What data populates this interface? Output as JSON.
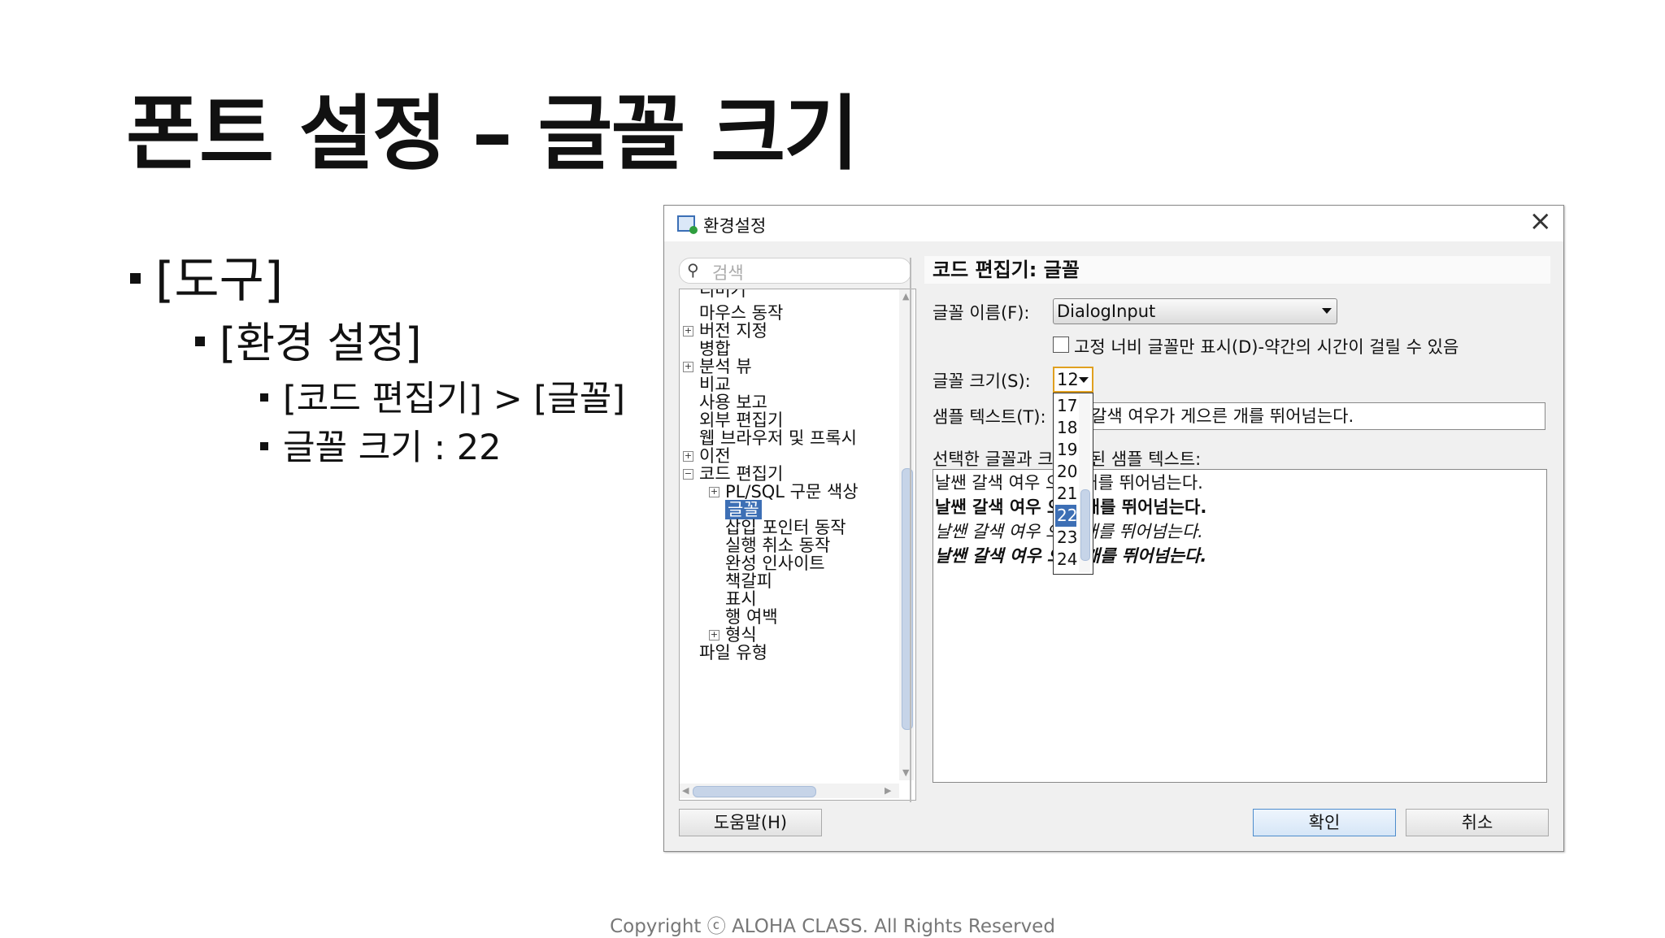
{
  "slide": {
    "title": "폰트 설정 – 글꼴 크기",
    "bullets": [
      "[도구]",
      "[환경 설정]",
      "[코드 편집기] > [글꼴]",
      "글꼴 크기 : 22"
    ],
    "footer": "Copyright ⓒ ALOHA CLASS. All Rights Reserved"
  },
  "dialog": {
    "title": "환경설정",
    "search_placeholder": "검색",
    "tree": [
      "디버거",
      "마우스 동작",
      "버전 지정",
      "병합",
      "분석 뷰",
      "비교",
      "사용 보고",
      "외부 편집기",
      "웹 브라우저 및 프록시",
      "이전",
      "코드 편집기",
      "PL/SQL 구문 색상",
      "글꼴",
      "삽입 포인터 동작",
      "실행 취소 동작",
      "완성 인사이트",
      "책갈피",
      "표시",
      "행 여백",
      "형식",
      "파일 유형"
    ],
    "section_title": "코드 편집기: 글꼴",
    "font_name_label": "글꼴 이름(F):",
    "font_name_value": "DialogInput",
    "fixed_width_label": "고정 너비 글꼴만 표시(D)-약간의 시간이 걸릴 수 있음",
    "font_size_label": "글꼴 크기(S):",
    "font_size_value": "12",
    "sample_text_label": "샘플 텍스트(T):",
    "sample_text_value": "갈색 여우가 게으른 개를 뛰어넘는다.",
    "preview_label": "선택한 글꼴과 크  표시된 샘플 텍스트:",
    "preview_lines": [
      "날쌘 갈색 여우   으른 개를 뛰어넘는다.",
      "날쌘 갈색 여우   으른 개를 뛰어넘는다.",
      "날쌘 갈색 여우   으른 개를 뛰어넘는다.",
      "날쌘 갈색 여우   으른 개를 뛰어넘는다."
    ],
    "size_options": [
      "17",
      "18",
      "19",
      "20",
      "21",
      "22",
      "23",
      "24"
    ],
    "size_selected": "22",
    "help_button": "도움말(H)",
    "ok_button": "확인",
    "cancel_button": "취소",
    "accent_color": "#3d6fb5"
  }
}
